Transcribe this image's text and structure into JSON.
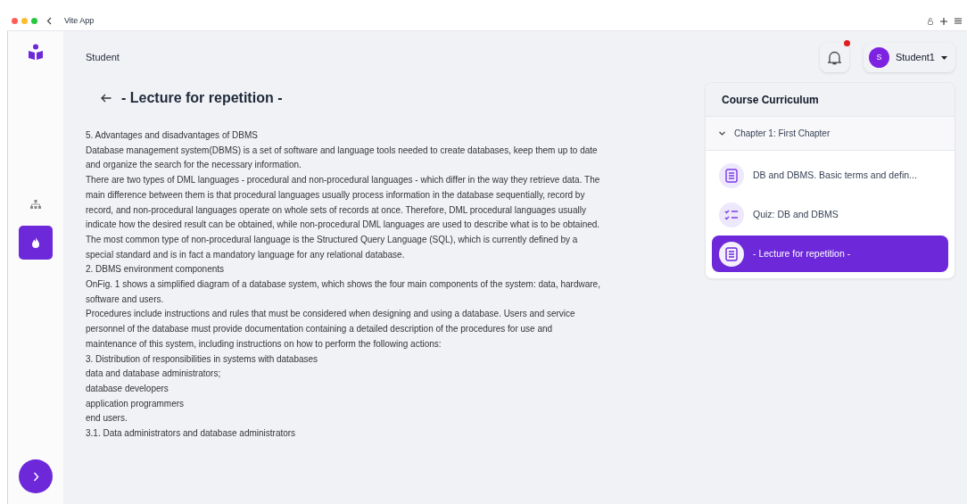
{
  "browser": {
    "title": "Vite App"
  },
  "sidebar": {
    "nav": [
      {
        "kind": "hierarchy",
        "selected": false
      },
      {
        "kind": "flame",
        "selected": true
      }
    ]
  },
  "header": {
    "section": "Student",
    "notifications": {
      "unread": true
    },
    "user": {
      "initial": "S",
      "name": "Student1"
    }
  },
  "lesson": {
    "title": "- Lecture for repetition -",
    "lines": [
      "5. Advantages and disadvantages of DBMS",
      "Database management system(DBMS) is a set of software and language tools needed to create databases, keep them up to date",
      "and organize the search for the necessary information.",
      "There are two types of DML languages - procedural and non-procedural languages - which differ in the way they retrieve data. The",
      "main difference between them is that procedural languages usually process information in the database sequentially, record by",
      "record, and non-procedural languages operate on whole sets of records at once. Therefore, DML procedural languages usually",
      "indicate how the desired result can be obtained, while non-procedural DML languages are used to describe what is to be obtained.",
      "The most common type of non-procedural language is the Structured Query Language (SQL), which is currently defined by a",
      "special standard and is in fact a mandatory language for any relational database.",
      "2. DBMS environment components",
      "OnFig. 1 shows a simplified diagram of a database system, which shows the four main components of the system: data, hardware,",
      "software and users.",
      "Procedures include instructions and rules that must be considered when designing and using a database. Users and service",
      "personnel of the database must provide documentation containing a detailed description of the procedures for use and",
      "maintenance of this system, including instructions on how to perform the following actions:",
      "3. Distribution of responsibilities in systems with databases",
      "data and database administrators;",
      "database developers",
      "application programmers",
      "end users.",
      "3.1. Data administrators and database administrators"
    ]
  },
  "curriculum": {
    "title": "Course Curriculum",
    "chapter": {
      "title": "Chapter 1: First Chapter",
      "expanded": true,
      "items": [
        {
          "kind": "lecture",
          "title": "DB and DBMS. Basic terms and defin...",
          "selected": false
        },
        {
          "kind": "quiz",
          "title": "Quiz: DB and DBMS",
          "selected": false
        },
        {
          "kind": "lecture",
          "title": "- Lecture for repetition -",
          "selected": true
        }
      ]
    }
  }
}
